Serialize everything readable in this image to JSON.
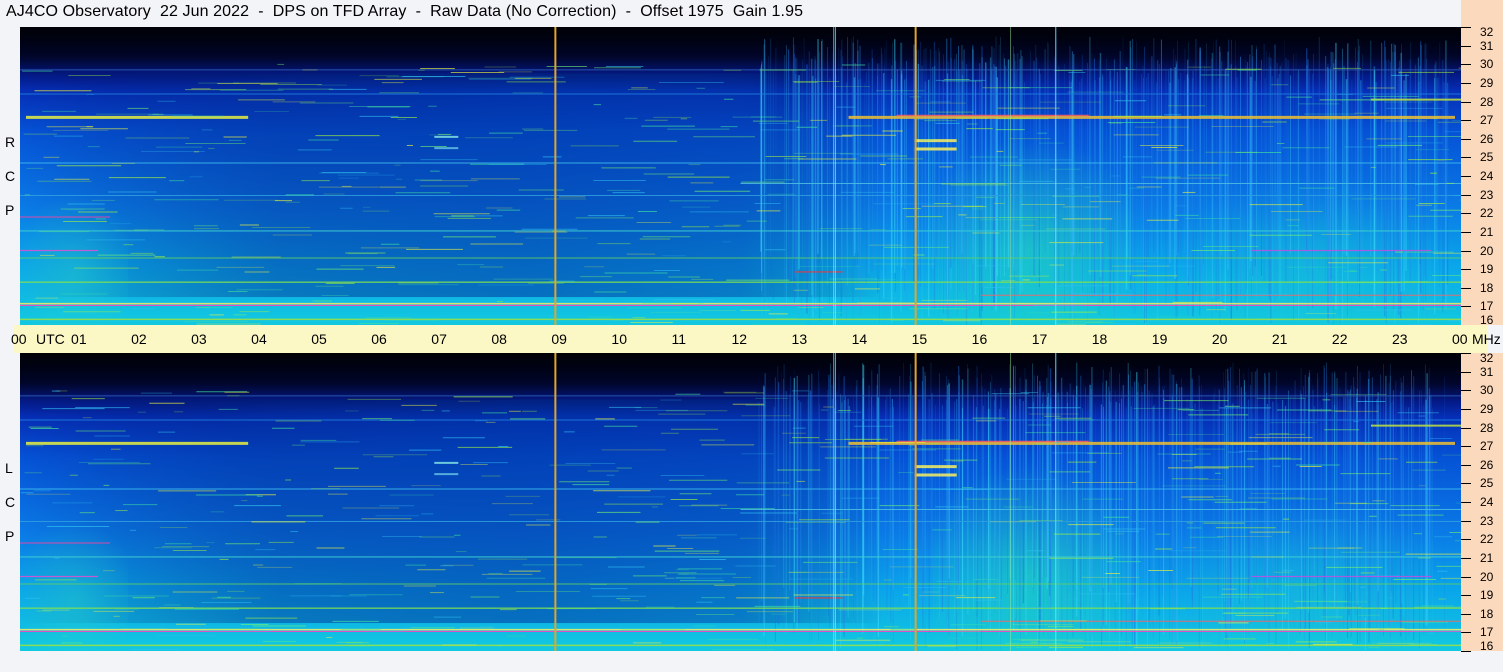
{
  "title": "AJ4CO Observatory  22 Jun 2022  -  DPS on TFD Array  -  Raw Data (No Correction)  -  Offset 1975  Gain 1.95",
  "chart_data": [
    {
      "type": "heatmap",
      "panel": "RCP",
      "polarization_letters": [
        "R",
        "C",
        "P"
      ],
      "x_ticks": [
        "00",
        "01",
        "02",
        "03",
        "04",
        "05",
        "06",
        "07",
        "08",
        "09",
        "10",
        "11",
        "12",
        "13",
        "14",
        "15",
        "16",
        "17",
        "18",
        "19",
        "20",
        "21",
        "22",
        "23",
        "00"
      ],
      "x_unit": "UTC",
      "y_ticks": [
        16,
        17,
        18,
        19,
        20,
        21,
        22,
        23,
        24,
        25,
        26,
        27,
        28,
        29,
        30,
        31,
        32
      ],
      "y_unit": "MHz",
      "ylim": [
        16,
        32
      ],
      "xlim_hours": [
        0,
        24
      ],
      "marker_times_utc": [
        9.0,
        15.0
      ]
    },
    {
      "type": "heatmap",
      "panel": "LCP",
      "polarization_letters": [
        "L",
        "C",
        "P"
      ],
      "x_ticks": [
        "00",
        "01",
        "02",
        "03",
        "04",
        "05",
        "06",
        "07",
        "08",
        "09",
        "10",
        "11",
        "12",
        "13",
        "14",
        "15",
        "16",
        "17",
        "18",
        "19",
        "20",
        "21",
        "22",
        "23",
        "00"
      ],
      "x_unit": "UTC",
      "y_ticks": [
        16,
        17,
        18,
        19,
        20,
        21,
        22,
        23,
        24,
        25,
        26,
        27,
        28,
        29,
        30,
        31,
        32
      ],
      "y_unit": "MHz",
      "ylim": [
        16,
        32
      ],
      "xlim_hours": [
        0,
        24
      ],
      "marker_times_utc": [
        9.0,
        15.0
      ]
    }
  ],
  "colors": {
    "marker": "#e0a52a",
    "freq_strip": "#fbd9bd",
    "time_strip": "#fbf8c6"
  }
}
